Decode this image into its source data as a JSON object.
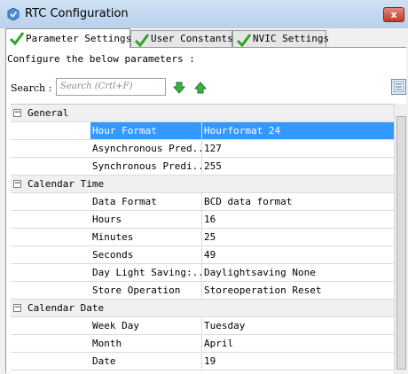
{
  "window": {
    "title": "RTC Configuration",
    "close_label": "x"
  },
  "tabs": [
    {
      "label": "Parameter Settings"
    },
    {
      "label": "User Constants"
    },
    {
      "label": "NVIC Settings"
    }
  ],
  "instruction": "Configure the below parameters :",
  "search": {
    "label": "Search :",
    "placeholder": "Search (Crtl+F)"
  },
  "groups": [
    {
      "label": "General",
      "toggle": "−",
      "rows": [
        {
          "name": "Hour Format",
          "value": "Hourformat 24"
        },
        {
          "name": "Asynchronous Pred...",
          "value": "127"
        },
        {
          "name": "Synchronous Predi...",
          "value": "255"
        }
      ]
    },
    {
      "label": "Calendar Time",
      "toggle": "−",
      "rows": [
        {
          "name": "Data Format",
          "value": "BCD data format"
        },
        {
          "name": "Hours",
          "value": "16"
        },
        {
          "name": "Minutes",
          "value": "25"
        },
        {
          "name": "Seconds",
          "value": "49"
        },
        {
          "name": "Day Light Saving:...",
          "value": "Daylightsaving None"
        },
        {
          "name": "Store Operation",
          "value": "Storeoperation Reset"
        }
      ]
    },
    {
      "label": "Calendar Date",
      "toggle": "−",
      "rows": [
        {
          "name": "Week Day",
          "value": "Tuesday"
        },
        {
          "name": "Month",
          "value": "April"
        },
        {
          "name": "Date",
          "value": "19"
        }
      ]
    }
  ],
  "colors": {
    "selection": "#3399ff",
    "accent_green": "#2aa52a"
  }
}
